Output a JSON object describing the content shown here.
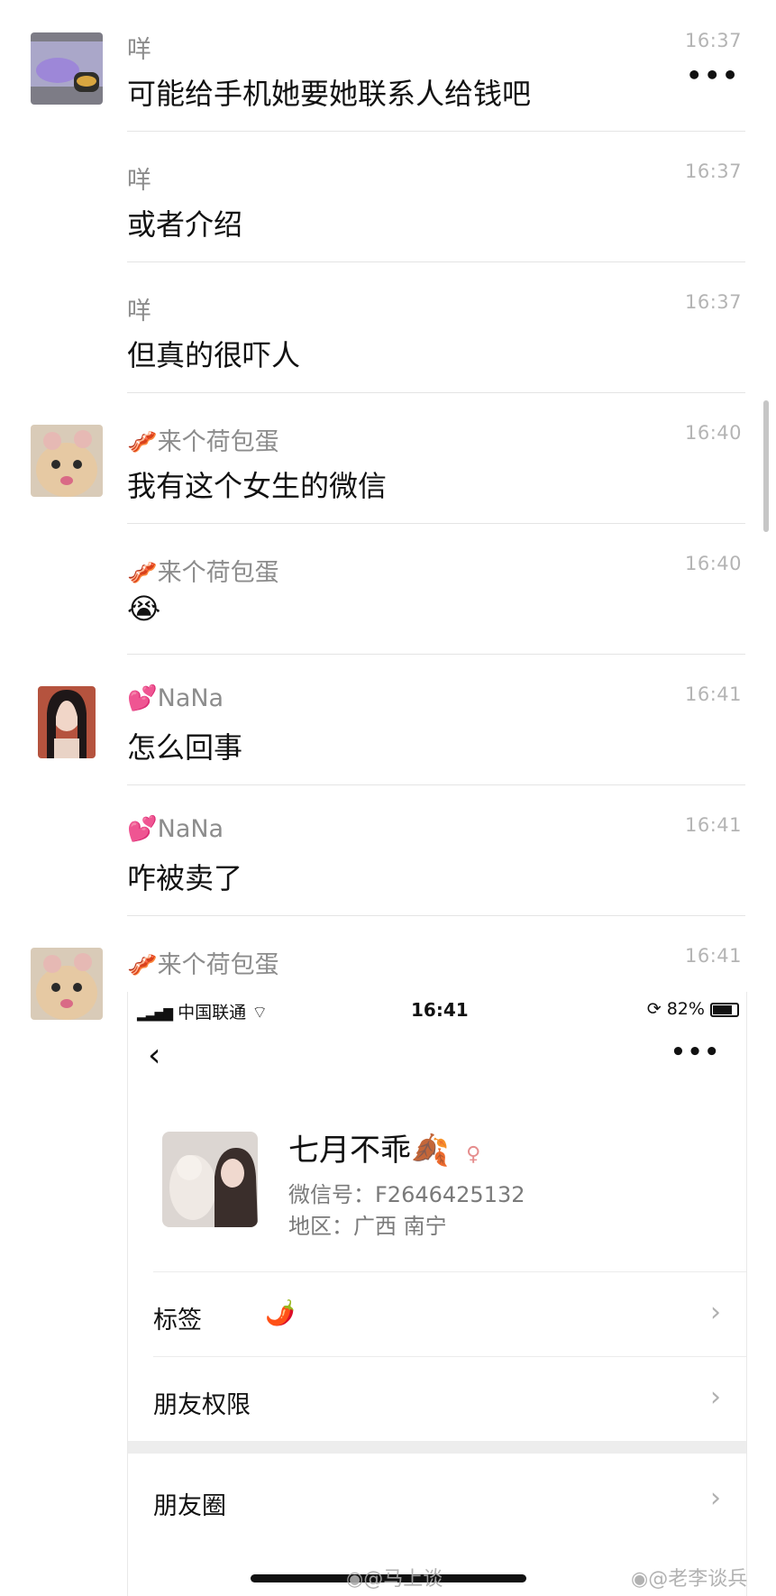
{
  "messages": [
    {
      "sender": "咩",
      "time": "16:37",
      "text": "可能给手机她要她联系人给钱吧"
    },
    {
      "sender": "咩",
      "time": "16:37",
      "text": "或者介绍"
    },
    {
      "sender": "咩",
      "time": "16:37",
      "text": "但真的很吓人"
    },
    {
      "sender": "🥓来个荷包蛋",
      "time": "16:40",
      "text": "我有这个女生的微信"
    },
    {
      "sender": "🥓来个荷包蛋",
      "time": "16:40",
      "text": "😭"
    },
    {
      "sender": "💕NaNa",
      "time": "16:41",
      "text": "怎么回事"
    },
    {
      "sender": "💕NaNa",
      "time": "16:41",
      "text": "咋被卖了"
    },
    {
      "sender": "🥓来个荷包蛋",
      "time": "16:41",
      "text": ""
    }
  ],
  "more_button": "•••",
  "embedded": {
    "status_bar": {
      "carrier": "中国联通",
      "time": "16:41",
      "battery": "82%"
    },
    "back": "‹",
    "more": "•••",
    "profile": {
      "name": "七月不乖",
      "name_icon": "🍂",
      "wechat_id": "微信号：F2646425132",
      "region": "地区：广西 南宁"
    },
    "rows": [
      {
        "label": "标签",
        "icon": "🌶️"
      },
      {
        "label": "朋友权限"
      },
      {
        "label": "朋友圈"
      }
    ],
    "chevron": "›"
  },
  "watermarks": [
    "@马上谈",
    "@老李谈兵"
  ]
}
